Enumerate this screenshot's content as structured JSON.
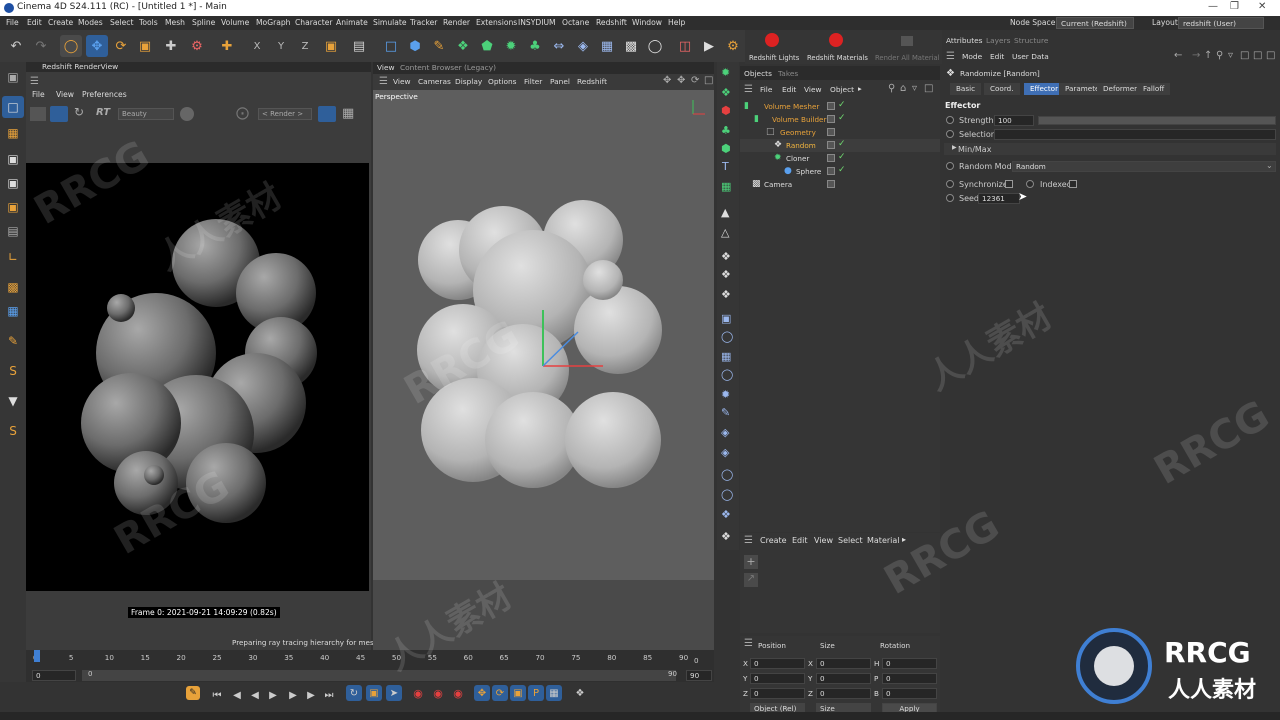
{
  "titlebar": {
    "title": "Cinema 4D S24.111 (RC) - [Untitled 1 *] - Main"
  },
  "menubar": {
    "items": [
      "File",
      "Edit",
      "Create",
      "Modes",
      "Select",
      "Tools",
      "Mesh",
      "Spline",
      "Volume",
      "MoGraph",
      "Character",
      "Animate",
      "Simulate",
      "Tracker",
      "Render",
      "Extensions",
      "INSYDIUM",
      "Octane",
      "Redshift",
      "Window",
      "Help"
    ],
    "node_space_label": "Node Space:",
    "node_space_value": "Current (Redshift)",
    "layout_label": "Layout:",
    "layout_value": "redshift (User)"
  },
  "renderview": {
    "title": "Redshift RenderView",
    "menu": [
      "File",
      "View",
      "Preferences"
    ],
    "rt": "RT",
    "aov": "Beauty",
    "render_dd": "< Render >",
    "frame_info": "Frame  0:  2021-09-21  14:09:29  (0.82s)",
    "status": "Preparing ray tracing hierarchy for meshes"
  },
  "viewport": {
    "tabs": [
      "View",
      "Content Browser (Legacy)"
    ],
    "menu": [
      "View",
      "Cameras",
      "Display",
      "Options",
      "Filter",
      "Panel",
      "Redshift"
    ],
    "label": "Perspective"
  },
  "redshift_bar": {
    "lights": "Redshift Lights",
    "materials": "Redshift Materials",
    "render_all": "Render All Material"
  },
  "objects": {
    "tabs": [
      "Objects",
      "Takes"
    ],
    "menu": [
      "File",
      "Edit",
      "View",
      "Object"
    ],
    "tree": [
      {
        "name": "Volume Mesher",
        "color": "#e8a23a"
      },
      {
        "name": "Volume Builder",
        "color": "#e8a23a"
      },
      {
        "name": "Geometry",
        "color": "#e8a23a"
      },
      {
        "name": "Random",
        "color": "#f2b53f"
      },
      {
        "name": "Cloner",
        "color": "#dddddd"
      },
      {
        "name": "Sphere",
        "color": "#dddddd"
      },
      {
        "name": "Camera",
        "color": "#dddddd"
      }
    ]
  },
  "materials": {
    "menu": [
      "Create",
      "Edit",
      "View",
      "Select",
      "Material"
    ]
  },
  "coords": {
    "headers": [
      "Position",
      "Size",
      "Rotation"
    ],
    "rows": [
      {
        "a": "X",
        "av": "0",
        "b": "X",
        "bv": "0",
        "c": "H",
        "cv": "0"
      },
      {
        "a": "Y",
        "av": "0",
        "b": "Y",
        "bv": "0",
        "c": "P",
        "cv": "0"
      },
      {
        "a": "Z",
        "av": "0",
        "b": "Z",
        "bv": "0",
        "c": "B",
        "cv": "0"
      }
    ],
    "mode": "Object (Rel)",
    "size_mode": "Size",
    "apply": "Apply"
  },
  "attributes": {
    "tabs": [
      "Attributes",
      "Layers",
      "Structure"
    ],
    "menu": [
      "Mode",
      "Edit",
      "User Data"
    ],
    "object": "Randomize [Random]",
    "subtabs": [
      "Basic",
      "Coord.",
      "Effector",
      "Parameter",
      "Deformer",
      "Falloff"
    ],
    "section": "Effector",
    "strength_label": "Strength",
    "strength_value": "100",
    "strength_fraction": 1.0,
    "selection_label": "Selection",
    "minmax_label": "Min/Max",
    "random_mode_label": "Random Mode",
    "random_mode_value": "Random",
    "synchronized_label": "Synchronized",
    "indexed_label": "Indexed",
    "seed_label": "Seed",
    "seed_value": "12361"
  },
  "timeline": {
    "ticks": [
      "0",
      "5",
      "10",
      "15",
      "20",
      "25",
      "30",
      "35",
      "40",
      "45",
      "50",
      "55",
      "60",
      "65",
      "70",
      "75",
      "80",
      "85",
      "90"
    ],
    "current_frame": "0",
    "start": "0",
    "start2": "0",
    "end": "90",
    "end2": "90",
    "frame_right": "0",
    "max_frame": 90
  },
  "watermark": {
    "text1": "RRCG",
    "text2": "人人素材"
  },
  "colors": {
    "accent": "#3f7fd3",
    "orange": "#e8a23a",
    "active_tab": "#3f6fb5",
    "bg": "#333333",
    "check": "#6fd86f"
  }
}
